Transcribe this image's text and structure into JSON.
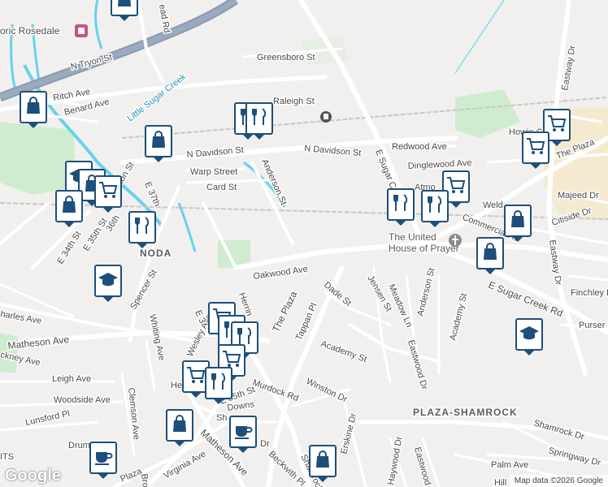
{
  "map": {
    "colors": {
      "land": "#f2f0ef",
      "road": "#ffffff",
      "highway": "#8a9bb0",
      "water": "#64d2ee",
      "park": "#cfeccf",
      "commercial": "#f5ead0",
      "marker_border": "#1d4f7a"
    },
    "labels": {
      "historic_rosedale": "oric Rosedale",
      "little_sugar_creek": "Little Sugar Creek",
      "n_tryon_st": "N Tryon St",
      "ritch_ave": "Ritch Ave",
      "benard_ave": "Benard Ave",
      "greensboro_st": "Greensboro St",
      "raleigh_st": "Raleigh St",
      "n_davidson_st_west": "N Davidson St",
      "n_davidson_st_east": "N Davidson St",
      "redwood_ave": "Redwood Ave",
      "dinglewood_ave": "Dinglewood Ave",
      "warp_street": "Warp Street",
      "card_st": "Card St",
      "anderson_st_north": "Anderson St",
      "e_sugar_creek_north": "E Sugar C",
      "atmore": "Atmo",
      "howie": "Howie C",
      "the_plaza_ne": "The Plaza",
      "eastway_dr_top": "Eastway Dr",
      "eastway_dr_east": "Eastway Dr",
      "majeed_dr": "Majeed Dr",
      "weld": "Weld",
      "citiside_dr": "Citiside Dr",
      "commercial_ave": "Commercial Av",
      "davidson_st_w": "avidson St",
      "e_37th": "E 37th",
      "e_36th": "36th",
      "e_35th_st": "E 35th St",
      "e_34th_st": "E 34th St",
      "spencer_st": "Spencer St",
      "oakwood_ave": "Oakwood Ave",
      "the_plaza": "The Plaza",
      "tappan_pl": "Tappan Pl",
      "dade_st": "Dade St",
      "jensen_st": "Jensen St",
      "meadow_ln": "Meadow Ln",
      "anderson_st_south": "Anderson St",
      "academy_st_east": "Academy St",
      "academy_st": "Academy St",
      "eastwood_dr": "Eastwood Dr",
      "e_sugar_creek_rd": "E Sugar Creek Rd",
      "finchley_dr": "Finchley Dr",
      "purser_dr": "Purser Dr",
      "charles_ave": "harles Ave",
      "matheson_ave_west": "Matheson Ave",
      "whiting_ave": "Whiting Ave",
      "wesley_ave": "Wesley Ave",
      "e_3": "E 3",
      "herrin": "Herrin",
      "hickney_ave": "ckney Ave",
      "leigh_ave": "Leigh Ave",
      "woodside_ave": "Woodside Ave",
      "lunsford_pl": "Lunsford Pl",
      "clemson_ave": "Clemson Ave",
      "murdock_rd": "Murdock Rd",
      "e_35th_st_south": "E 35th St",
      "downs": "Downs",
      "winston_dr": "Winston Dr",
      "erskine_dr": "Erskine Dr",
      "shamrock_dr": "Shamrock Dr",
      "shamrock_dr_south": "Shamrock Dr",
      "plaza_shamrock": "PLAZA-SHAMROCK",
      "noda": "NODA",
      "church": "The United\nHouse of Prayer",
      "springway_dr": "Springway Dr",
      "palm_ave": "Palm Ave",
      "matheson_ave_south": "Matheson Ave",
      "virginia_ave": "Virginia Ave",
      "beckwith_pl": "Beckwith Pl",
      "haywood_dr": "Haywood Dr",
      "eastwood_dr_south": "Eastwood Dr",
      "the_plaza_south": "Plaza",
      "its": "ITS",
      "drummond": "Drummon",
      "he": "He",
      "broad": "Bro",
      "mead_rd": "ead Rd",
      "sh_dr": "Sh",
      "ck_dr": "Dr",
      "hill": "Hill"
    },
    "markers": [
      {
        "id": "m1",
        "icon": "shopping-bag-icon"
      },
      {
        "id": "m2",
        "icon": "shopping-bag-icon"
      },
      {
        "id": "m3",
        "icon": "restaurant-icon"
      },
      {
        "id": "m4",
        "icon": "shopping-bag-icon"
      },
      {
        "id": "m5",
        "icon": "shopping-cart-icon"
      },
      {
        "id": "m6",
        "icon": "shopping-cart-icon"
      },
      {
        "id": "m7",
        "icon": "school-icon"
      },
      {
        "id": "m8",
        "icon": "shopping-bag-icon"
      },
      {
        "id": "m9",
        "icon": "shopping-cart-icon"
      },
      {
        "id": "m10",
        "icon": "restaurant-icon"
      },
      {
        "id": "m11",
        "icon": "school-icon"
      },
      {
        "id": "m12",
        "icon": "restaurant-icon"
      },
      {
        "id": "m13",
        "icon": "restaurant-icon"
      },
      {
        "id": "m14",
        "icon": "restaurant-icon"
      },
      {
        "id": "m15",
        "icon": "shopping-cart-icon"
      },
      {
        "id": "m16",
        "icon": "shopping-bag-icon"
      },
      {
        "id": "m17",
        "icon": "shopping-bag-icon"
      },
      {
        "id": "m18",
        "icon": "school-icon"
      },
      {
        "id": "m19",
        "icon": "shopping-cart-icon"
      },
      {
        "id": "m20",
        "icon": "restaurant-icon"
      },
      {
        "id": "m21",
        "icon": "restaurant-icon"
      },
      {
        "id": "m22",
        "icon": "shopping-cart-icon"
      },
      {
        "id": "m23",
        "icon": "restaurant-icon"
      },
      {
        "id": "m24",
        "icon": "shopping-bag-icon"
      },
      {
        "id": "m25",
        "icon": "cafe-icon"
      },
      {
        "id": "m26",
        "icon": "cafe-icon"
      },
      {
        "id": "m27",
        "icon": "shopping-bag-icon"
      },
      {
        "id": "m28",
        "icon": "school-icon"
      }
    ],
    "attribution": "Map data ©2026 Google",
    "logo": "Google"
  }
}
